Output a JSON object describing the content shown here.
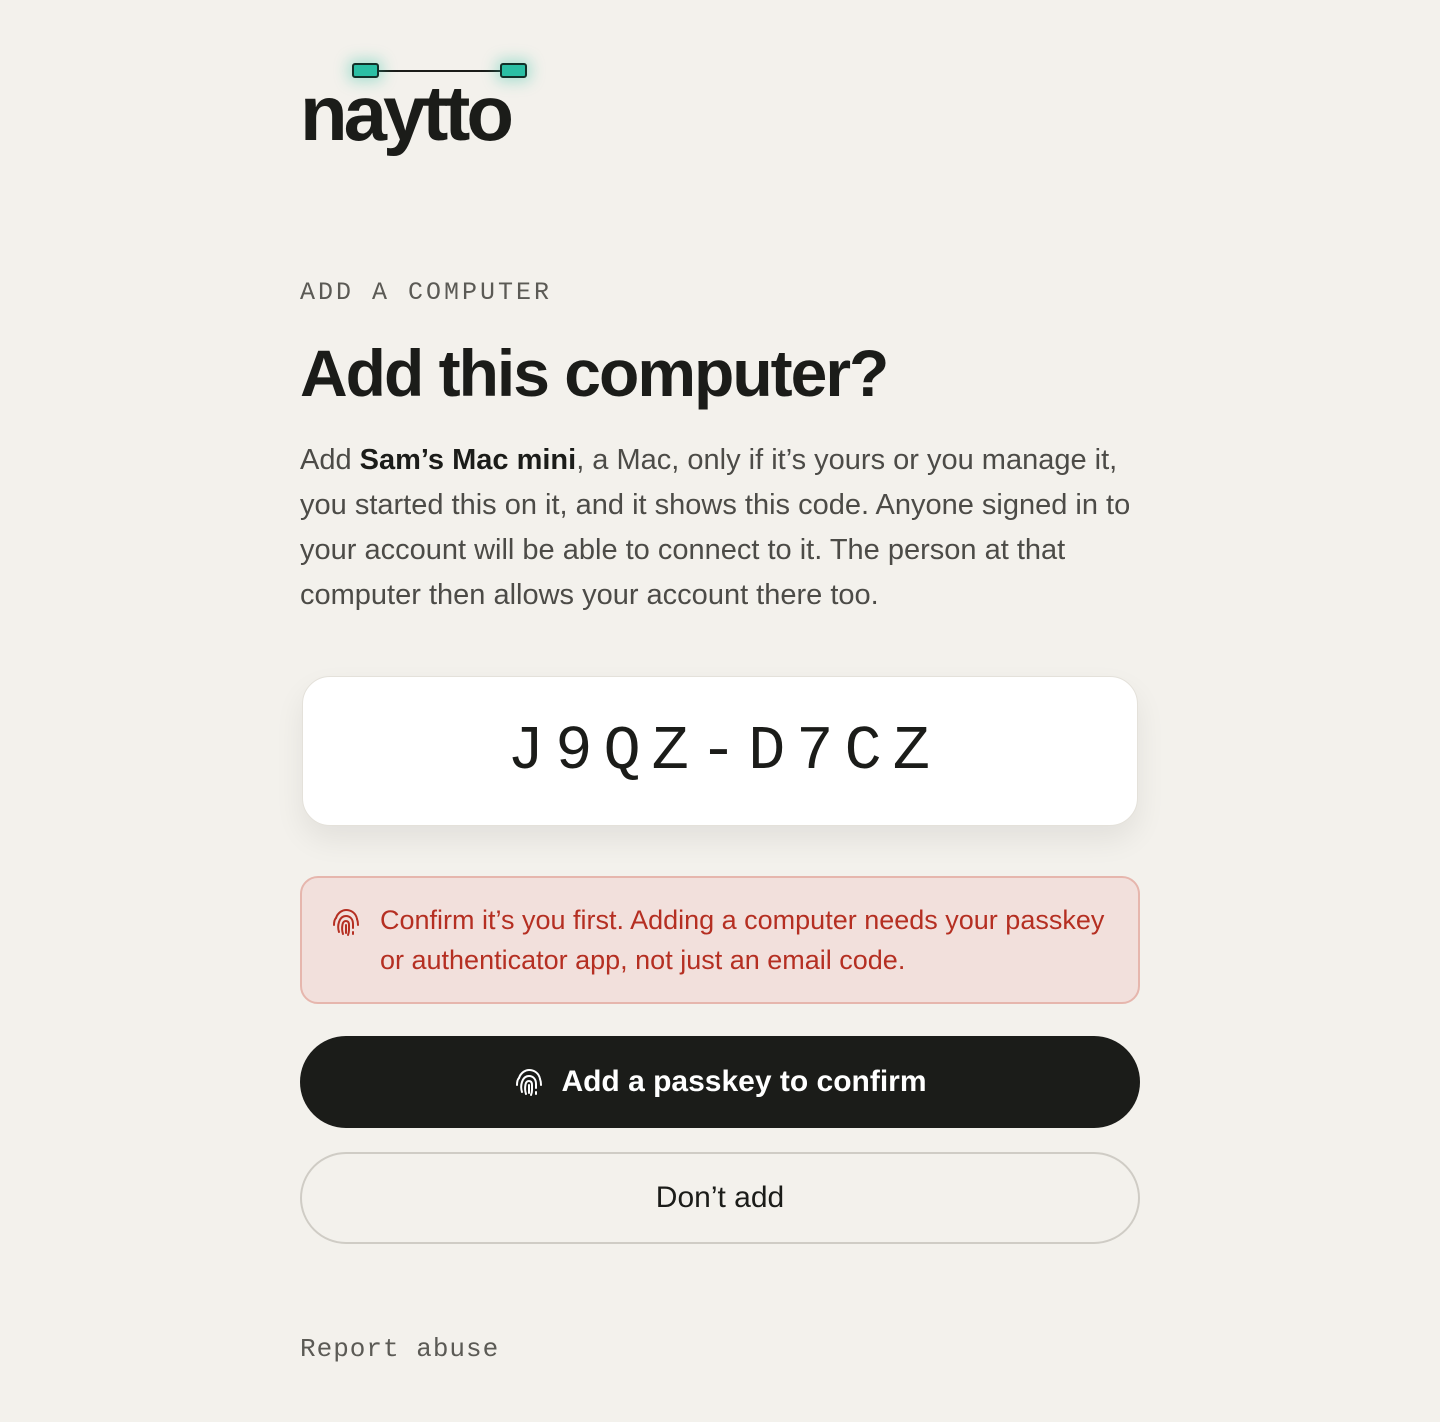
{
  "brand": {
    "name": "naytto",
    "accent": "#2bbfa4"
  },
  "eyebrow": "ADD A COMPUTER",
  "title": "Add this computer?",
  "description": {
    "prefix": "Add ",
    "device_name": "Sam’s Mac mini",
    "suffix": ", a Mac, only if it’s yours or you manage it, you started this on it, and it shows this code. Anyone signed in to your account will be able to connect to it. The person at that computer then allows your account there too."
  },
  "code": "J9QZ-D7CZ",
  "alert": {
    "icon": "fingerprint-icon",
    "text": "Confirm it’s you first. Adding a computer needs your passkey or authenticator app, not just an email code.",
    "color": "#b52f22"
  },
  "primary_button": {
    "icon": "fingerprint-icon",
    "label": "Add a passkey to confirm"
  },
  "secondary_button": {
    "label": "Don’t add"
  },
  "footer": {
    "report_label": "Report abuse"
  }
}
